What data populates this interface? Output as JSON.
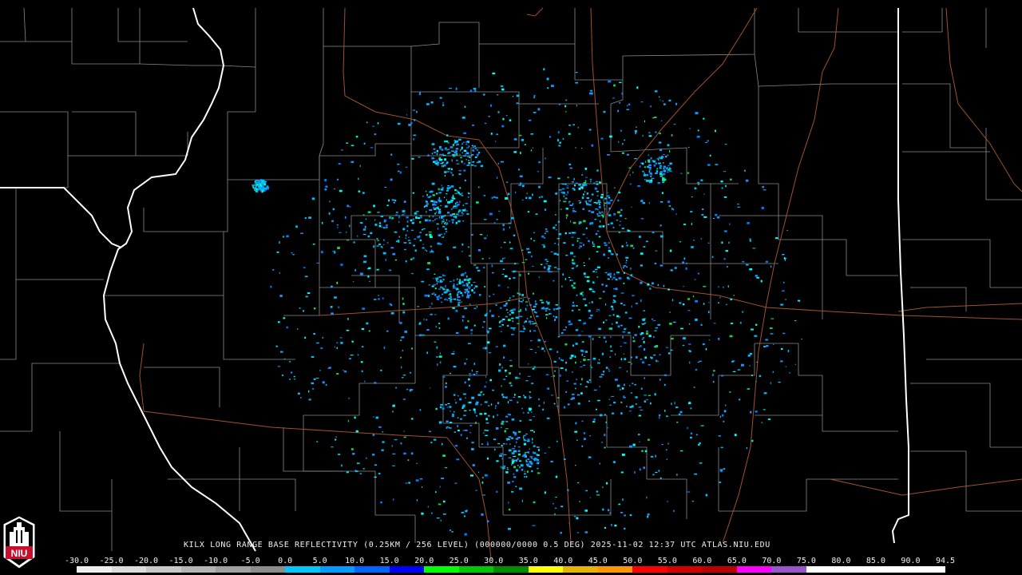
{
  "caption": "KILX LONG RANGE BASE REFLECTIVITY (0.25KM / 256 LEVEL) (000000/0000 0.5 DEG) 2025-11-02 12:37 UTC  ATLAS.NIU.EDU",
  "logo": {
    "text": "NIU",
    "colors": {
      "red": "#c8102e",
      "white": "#ffffff",
      "black": "#000000"
    }
  },
  "scale": {
    "unit_values": [
      "-30.0",
      "-25.0",
      "-20.0",
      "-15.0",
      "-10.0",
      "-5.0",
      "0.0",
      "5.0",
      "10.0",
      "15.0",
      "20.0",
      "25.0",
      "30.0",
      "35.0",
      "40.0",
      "45.0",
      "50.0",
      "55.0",
      "60.0",
      "65.0",
      "70.0",
      "75.0",
      "80.0",
      "85.0",
      "90.0",
      "94.5"
    ],
    "colors": [
      "#eeeeee",
      "#dcdcdc",
      "#c8c8c8",
      "#b4b4b4",
      "#a0a0a0",
      "#8c8c8c",
      "#00c8ff",
      "#009cff",
      "#0064ff",
      "#0000ff",
      "#00ff00",
      "#00c800",
      "#008c00",
      "#ffff00",
      "#e6b400",
      "#ff9600",
      "#ff0000",
      "#d40000",
      "#bc0000",
      "#ff00ff",
      "#9955c9",
      "#ffffff",
      "#ffffff",
      "#ffffff",
      "#ffffff"
    ]
  },
  "map": {
    "background": "#000000",
    "county_line_color": "#8a8a8a",
    "state_line_color": "#ffffff",
    "road_color": "#a0522d",
    "echo_colors": [
      "#00bfff",
      "#1e90ff",
      "#00ffff",
      "#0080ff",
      "#22cc44",
      "#00ff80"
    ]
  }
}
